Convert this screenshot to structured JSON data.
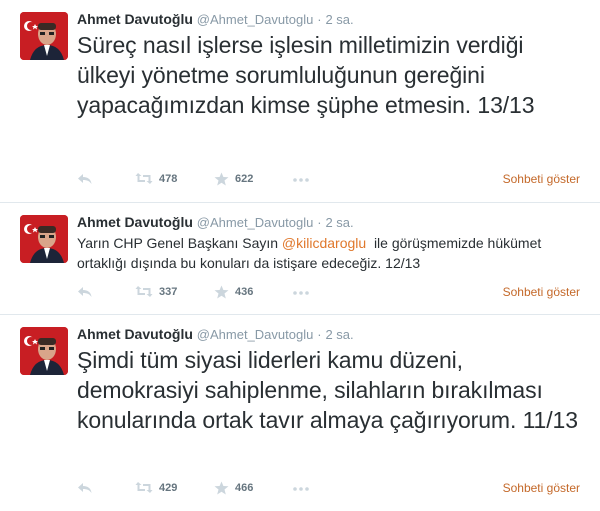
{
  "tweets": [
    {
      "author_name": "Ahmet Davutoğlu",
      "username": "@Ahmet_Davutoglu",
      "separator": "·",
      "time": "2 sa.",
      "text": "Süreç nasıl işlerse işlesin milletimizin verdiği ülkeyi yönetme sorumluluğunun gereğini yapacağımızdan kimse şüphe etmesin. 13/13",
      "retweets": "478",
      "favorites": "622",
      "conversation_link": "Sohbeti göster"
    },
    {
      "author_name": "Ahmet Davutoğlu",
      "username": "@Ahmet_Davutoglu",
      "separator": "·",
      "time": "2 sa.",
      "text_before": "Yarın CHP Genel Başkanı Sayın ",
      "mention": "@kilicdaroglu",
      "text_after": "  ile görüşmemizde hükümet ortaklığı dışında bu konuları da istişare edeceğiz. 12/13",
      "retweets": "337",
      "favorites": "436",
      "conversation_link": "Sohbeti göster"
    },
    {
      "author_name": "Ahmet Davutoğlu",
      "username": "@Ahmet_Davutoglu",
      "separator": "·",
      "time": "2 sa.",
      "text": "Şimdi tüm siyasi liderleri kamu düzeni, demokrasiyi sahiplenme, silahların bırakılması konularında ortak tavır almaya çağırıyorum. 11/13",
      "retweets": "429",
      "favorites": "466",
      "conversation_link": "Sohbeti göster"
    }
  ],
  "icons": {
    "reply": "reply-icon",
    "retweet": "retweet-icon",
    "favorite": "star-icon",
    "more": "more-icon"
  },
  "colors": {
    "mention": "#e0782c",
    "conversation_link": "#c4692a",
    "meta": "#8899a6",
    "divider": "#e1e8ed"
  }
}
